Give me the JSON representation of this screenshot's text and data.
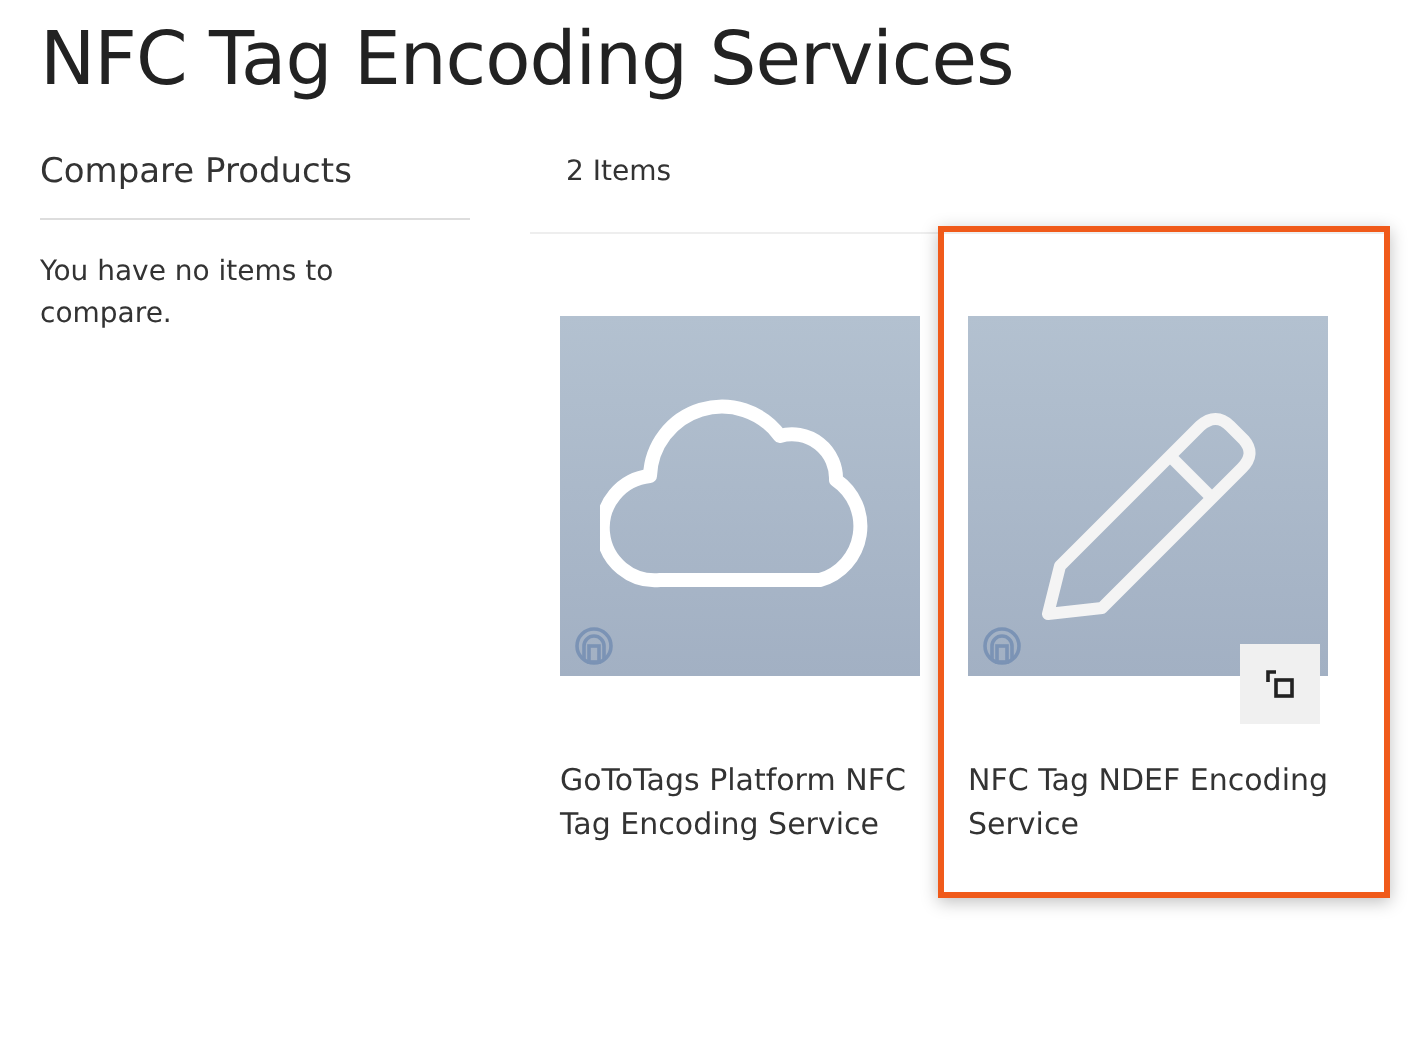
{
  "page_title": "NFC Tag Encoding Services",
  "sidebar": {
    "title": "Compare Products",
    "message": "You have no items to compare."
  },
  "toolbar": {
    "count": "2 Items"
  },
  "products": [
    {
      "name": "GoToTags Platform NFC Tag Encoding Service",
      "kind": "cloud",
      "selected": false
    },
    {
      "name": "NFC Tag NDEF Encoding Service",
      "kind": "pencil",
      "selected": true
    }
  ]
}
